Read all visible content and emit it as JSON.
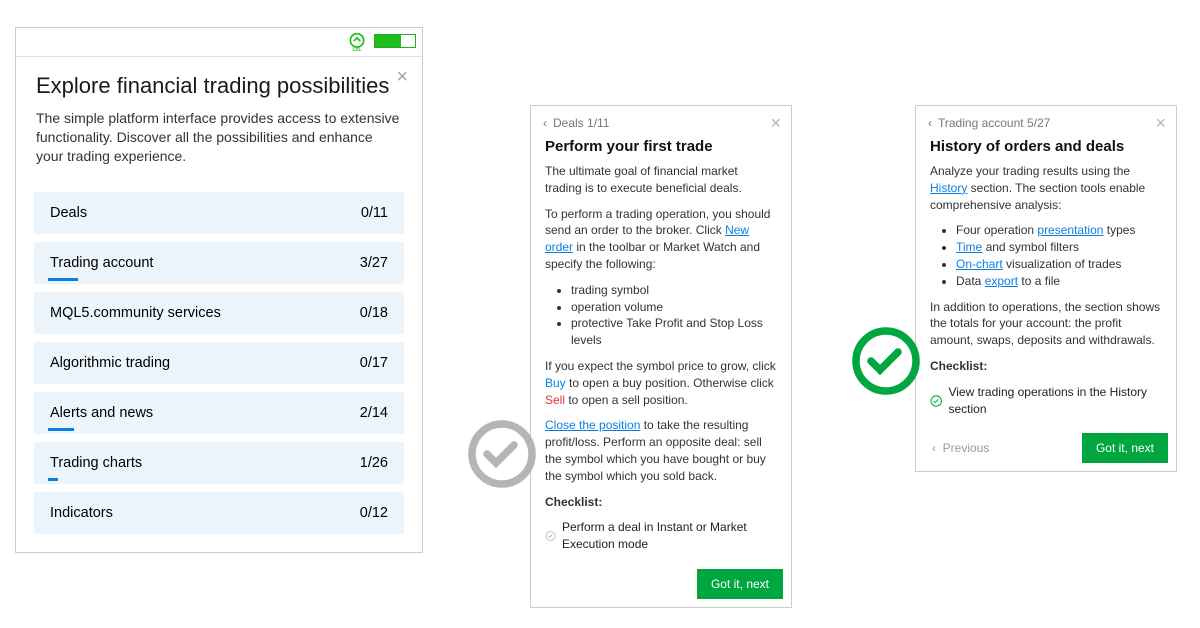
{
  "panel": {
    "title": "Explore financial trading possibilities",
    "desc": "The simple platform interface provides access to extensive functionality. Discover all the possibilities and enhance your trading experience.",
    "categories": [
      {
        "label": "Deals",
        "count": "0/11"
      },
      {
        "label": "Trading account",
        "count": "3/27"
      },
      {
        "label": "MQL5.community services",
        "count": "0/18"
      },
      {
        "label": "Algorithmic trading",
        "count": "0/17"
      },
      {
        "label": "Alerts and news",
        "count": "2/14"
      },
      {
        "label": "Trading charts",
        "count": "1/26"
      },
      {
        "label": "Indicators",
        "count": "0/12"
      }
    ]
  },
  "deals": {
    "crumb": "Deals 1/11",
    "title": "Perform your first trade",
    "p1": "The ultimate goal of financial market trading is to execute beneficial deals.",
    "p2a": "To perform a trading operation, you should send an order to the broker. Click ",
    "p2link": "New order",
    "p2b": " in the toolbar or Market Watch and specify the following:",
    "bul1": "trading symbol",
    "bul2": "operation volume",
    "bul3": "protective Take Profit and Stop Loss levels",
    "p3a": "If you expect the symbol price to grow, click ",
    "p3buy": "Buy",
    "p3b": " to open a buy position. Otherwise click ",
    "p3sell": "Sell",
    "p3c": " to open a sell position.",
    "p4link": "Close the position",
    "p4": " to take the resulting profit/loss. Perform an opposite deal: sell the symbol which you have bought or buy the symbol which you sold back.",
    "checklist": "Checklist:",
    "item": "Perform a deal in Instant or Market Execution mode",
    "next": "Got it, next"
  },
  "history": {
    "crumb": "Trading account 5/27",
    "title": "History of orders and deals",
    "p1a": "Analyze your trading results using the ",
    "p1link": "History",
    "p1b": " section. The section tools enable comprehensive analysis:",
    "bul1a": "Four operation ",
    "bul1link": "presentation",
    "bul1b": " types",
    "bul2link": "Time",
    "bul2b": " and symbol filters",
    "bul3link": "On-chart",
    "bul3b": " visualization of trades",
    "bul4a": "Data ",
    "bul4link": "export",
    "bul4b": " to a file",
    "p2": "In addition to operations, the section shows the totals for your account: the profit amount, swaps, deposits and withdrawals.",
    "checklist": "Checklist:",
    "item": "View trading operations in the History section",
    "prev": "Previous",
    "next": "Got it, next"
  }
}
